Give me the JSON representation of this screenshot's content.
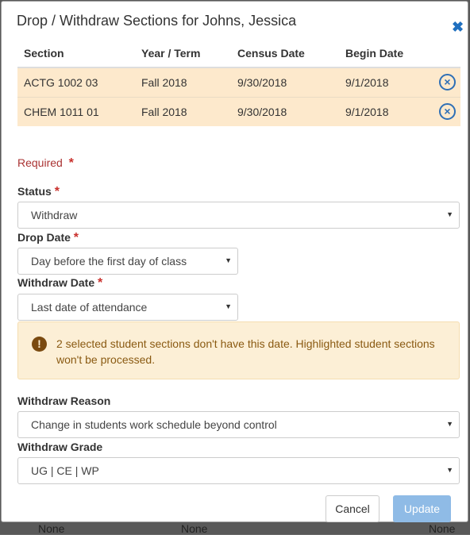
{
  "background": {
    "row_text_1": "None",
    "row_text_2": "None",
    "row_text_3": "None"
  },
  "modal": {
    "title": "Drop / Withdraw Sections for Johns, Jessica",
    "close_icon": "close-icon"
  },
  "sections_table": {
    "headers": [
      "Section",
      "Year / Term",
      "Census Date",
      "Begin Date"
    ],
    "rows": [
      {
        "section": "ACTG 1002 03",
        "term": "Fall 2018",
        "census": "9/30/2018",
        "begin": "9/1/2018"
      },
      {
        "section": "CHEM 1011 01",
        "term": "Fall 2018",
        "census": "9/30/2018",
        "begin": "9/1/2018"
      }
    ],
    "row_highlight_color": "#fde9cc"
  },
  "form": {
    "required_note": "Required",
    "required_star": "*",
    "status_label": "Status",
    "status_value": "Withdraw",
    "drop_date_label": "Drop Date",
    "drop_date_value": "Day before the first day of class",
    "withdraw_date_label": "Withdraw Date",
    "withdraw_date_value": "Last date of attendance",
    "alert_text": "2 selected student sections don't have this date. Highlighted student sections won't be processed.",
    "alert_icon": "exclamation-circle-icon",
    "withdraw_reason_label": "Withdraw Reason",
    "withdraw_reason_value": "Change in students work schedule beyond control",
    "withdraw_grade_label": "Withdraw Grade",
    "withdraw_grade_value": "UG | CE | WP"
  },
  "footer": {
    "cancel_label": "Cancel",
    "update_label": "Update"
  },
  "colors": {
    "accent": "#2e6fb6",
    "required": "#c9302c",
    "update_button_disabled": "#8fbbe6"
  }
}
